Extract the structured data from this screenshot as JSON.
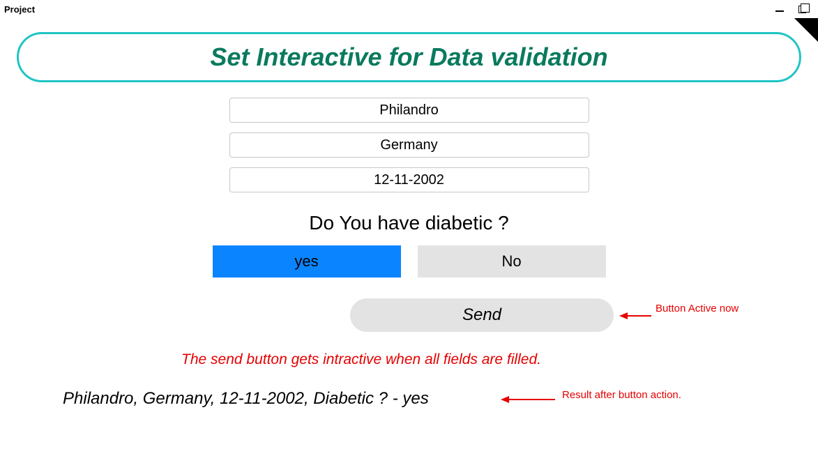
{
  "window": {
    "title": "Project"
  },
  "header": {
    "title": "Set Interactive for Data validation"
  },
  "form": {
    "name": "Philandro",
    "country": "Germany",
    "date": "12-11-2002",
    "question": "Do You have diabetic ?",
    "yes_label": "yes",
    "no_label": "No",
    "selected": "yes",
    "send_label": "Send"
  },
  "annotations": {
    "button_active": "Button Active now",
    "note": "The send button gets  intractive when all fields are filled.",
    "result_label": "Result after button action."
  },
  "result": "Philandro,  Germany,  12-11-2002,  Diabetic ?  - yes"
}
